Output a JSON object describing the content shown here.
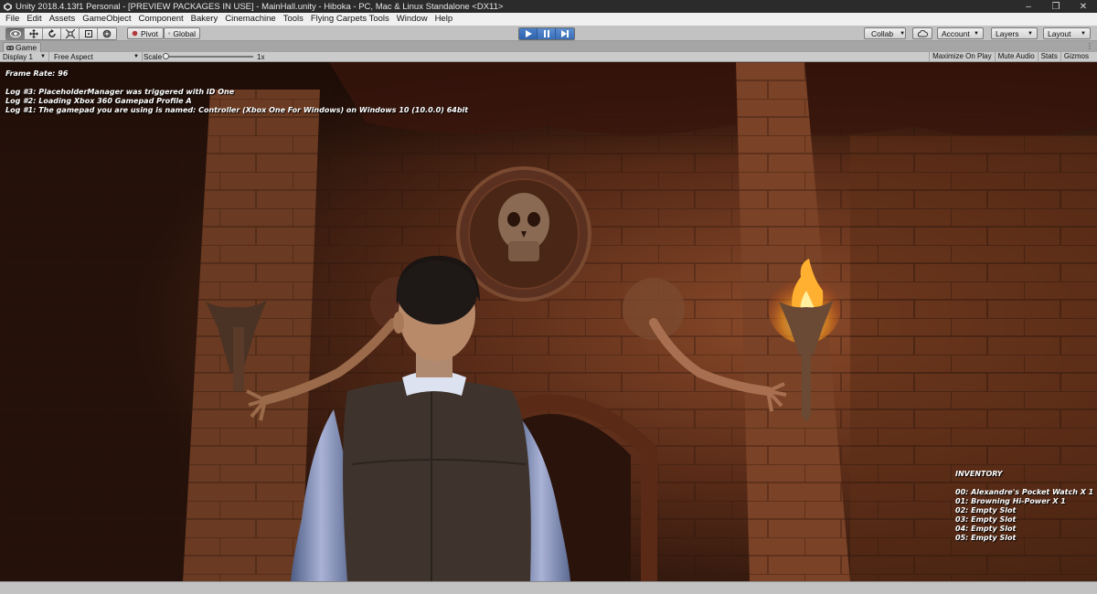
{
  "window": {
    "title": "Unity 2018.4.13f1 Personal - [PREVIEW PACKAGES IN USE] - MainHall.unity - Hiboka - PC, Mac & Linux Standalone <DX11>",
    "controls": [
      "–",
      "❐",
      "✕"
    ]
  },
  "menu": [
    "File",
    "Edit",
    "Assets",
    "GameObject",
    "Component",
    "Bakery",
    "Cinemachine",
    "Tools",
    "Flying Carpets Tools",
    "Window",
    "Help"
  ],
  "toolbar": {
    "tools": [
      "hand-tool",
      "move-tool",
      "rotate-tool",
      "scale-tool",
      "rect-tool",
      "transform-tool"
    ],
    "pivot_label": "Pivot",
    "global_label": "Global",
    "collab_label": "Collab",
    "account_label": "Account",
    "layers_label": "Layers",
    "layout_label": "Layout"
  },
  "game_tab": {
    "label": "Game"
  },
  "game_view": {
    "display": "Display 1",
    "aspect": "Free Aspect",
    "scale_label": "Scale",
    "scale_value": "1x",
    "toggles": [
      "Maximize On Play",
      "Mute Audio",
      "Stats",
      "Gizmos"
    ]
  },
  "overlay": {
    "frame_rate": "Frame Rate: 96",
    "logs": [
      "Log #3: PlaceholderManager was triggered with ID One",
      "Log #2: Loading Xbox 360 Gamepad Profile A",
      "Log #1: The gamepad you are using is named: Controller (Xbox One For Windows) on Windows 10  (10.0.0) 64bit"
    ],
    "inventory_title": "INVENTORY",
    "inventory": [
      "00: Alexandre's Pocket Watch X 1",
      "01: Browning Hi-Power X 1",
      "02: Empty Slot",
      "03: Empty Slot",
      "04: Empty Slot",
      "05: Empty Slot"
    ]
  },
  "colors": {
    "play_accent": "#3a6fb8",
    "titlebar": "#2b2b2b",
    "editor_gray": "#c2c2c2"
  }
}
